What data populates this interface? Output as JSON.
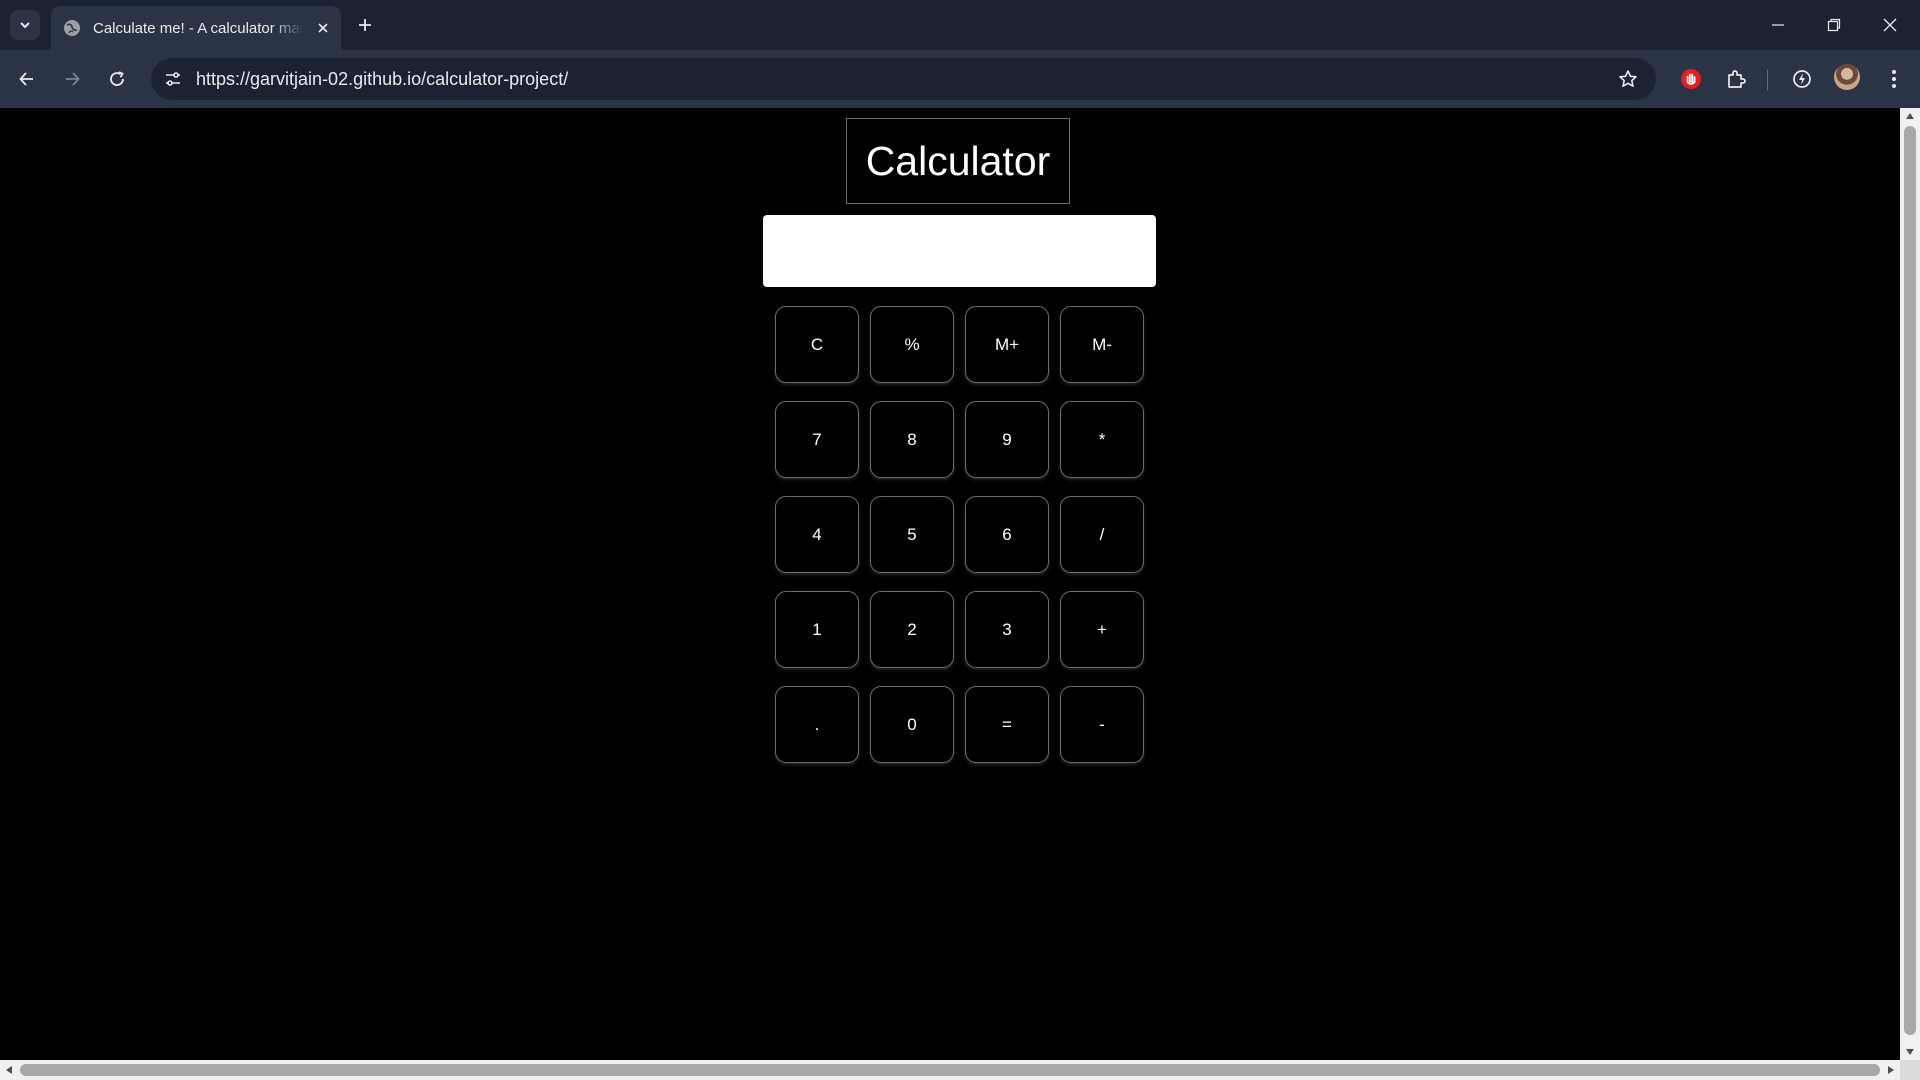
{
  "browser": {
    "tab": {
      "title": "Calculate me! - A calculator made using HTML, CSS and JavaScript"
    },
    "address_bar": {
      "url": "https://garvitjain-02.github.io/calculator-project/"
    },
    "icons": [
      "tab-search-icon",
      "globe-icon",
      "close-icon",
      "plus-icon",
      "minimize-icon",
      "restore-icon",
      "back-icon",
      "forward-icon",
      "reload-icon",
      "site-info-icon",
      "star-icon",
      "extension-red-icon",
      "puzzle-icon",
      "performance-icon",
      "avatar",
      "kebab-menu-icon"
    ]
  },
  "page": {
    "title": "Calculator",
    "display": {
      "value": ""
    },
    "keys": [
      "C",
      "%",
      "M+",
      "M-",
      "7",
      "8",
      "9",
      "*",
      "4",
      "5",
      "6",
      "/",
      "1",
      "2",
      "3",
      "+",
      ".",
      "0",
      "=",
      "-"
    ]
  },
  "colors": {
    "chrome_dark": "#1b2333",
    "chrome_toolbar": "#2a3446",
    "page_background": "#000000",
    "key_border": "#6d6d6d",
    "display_background": "#ffffff"
  }
}
